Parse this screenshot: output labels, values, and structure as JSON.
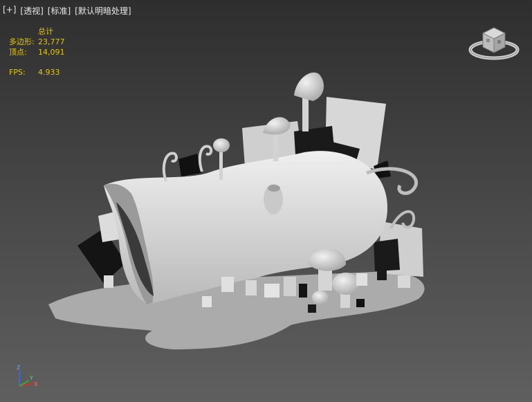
{
  "viewport": {
    "menu": [
      "[+]",
      "[透视]",
      "[标准]",
      "[默认明暗处理]"
    ]
  },
  "stats": {
    "total_label": "总计",
    "polygons_label": "多边形:",
    "polygons_value": "23,777",
    "vertices_label": "顶点:",
    "vertices_value": "14,091",
    "fps_label": "FPS:",
    "fps_value": "4.933"
  },
  "axis": {
    "z": "Z",
    "x": "X",
    "y": "Y"
  },
  "colors": {
    "stats": "#e6c800",
    "model": "#d7d7d7",
    "shadow": "#a9a9a9"
  }
}
